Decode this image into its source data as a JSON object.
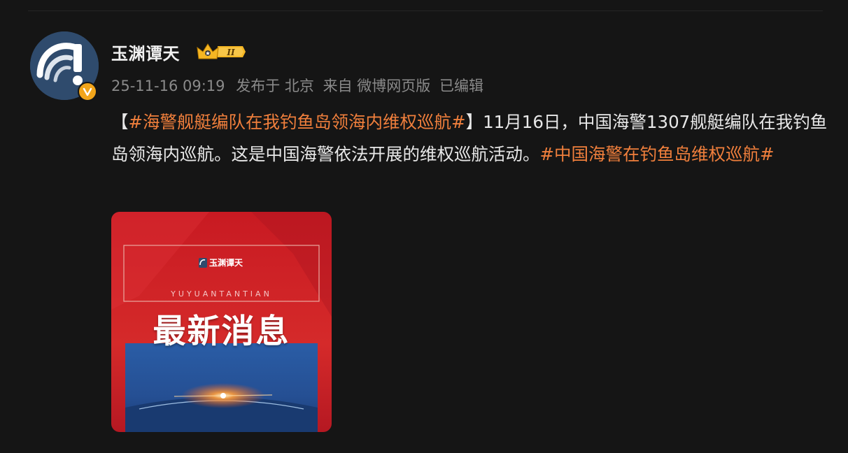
{
  "post": {
    "author": {
      "name": "玉渊谭天",
      "rank_level": "II"
    },
    "meta": {
      "timestamp": "25-11-16 09:19",
      "published_in": "发布于 北京",
      "source": "来自 微博网页版",
      "edited": "已编辑"
    },
    "content": {
      "bracket_open": "【",
      "hashtag_1": "#海警舰艇编队在我钓鱼岛领海内维权巡航#",
      "bracket_close": "】",
      "text": "11月16日，中国海警1307舰艇编队在我钓鱼岛领海内巡航。这是中国海警依法开展的维权巡航活动。",
      "hashtag_2": "#中国海警在钓鱼岛维权巡航#"
    },
    "image": {
      "logo_text": "玉渊谭天",
      "subtitle": "YUYUANTANTIAN",
      "headline": "最新消息"
    }
  },
  "colors": {
    "background": "#151515",
    "hashtag": "#f07f3c",
    "meta": "#8a8a8a",
    "badge_gold": "#f2a51a"
  },
  "icons": {
    "verified": "verified-v-icon",
    "rank": "crown-rank-badge-icon"
  }
}
